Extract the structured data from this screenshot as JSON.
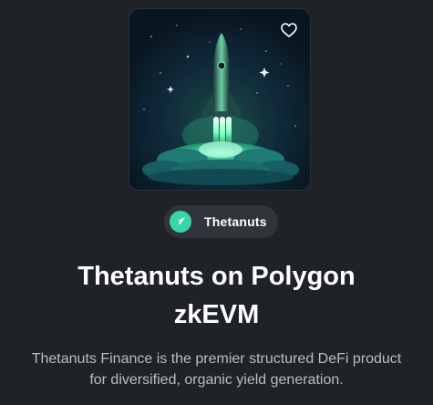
{
  "product": {
    "image": {
      "subject": "rocket launching from green cloud burst on dark blue starry sky",
      "favorite_icon": "heart-outline-icon"
    },
    "protocol_chip": {
      "icon": "thetanuts-logo-icon",
      "label": "Thetanuts"
    },
    "title": "Thetanuts on Polygon zkEVM",
    "description": "Thetanuts Finance is the premier structured DeFi product for diversified, organic yield generation."
  },
  "colors": {
    "background": "#1f2227",
    "chip_background": "#30343b",
    "brand_accent": "#39d4a7",
    "description_text": "#b8bdc6",
    "title_text": "#ffffff"
  }
}
